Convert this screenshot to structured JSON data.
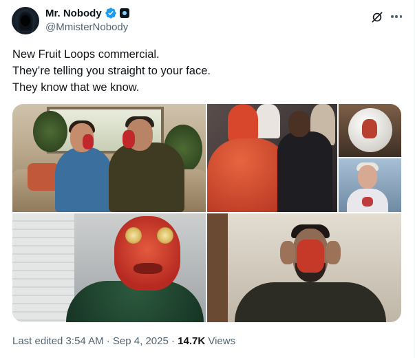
{
  "author": {
    "display_name": "Mr. Nobody",
    "handle": "@MmisterNobody",
    "verified_color": "#1d9bf0"
  },
  "header_icons": [
    "grok-icon",
    "more-icon"
  ],
  "tweet": {
    "lines": [
      "New Fruit Loops commercial.",
      "They’re telling you straight to your face.",
      "They know that we know."
    ]
  },
  "footer": {
    "edited": "Last edited 3:54 AM · Sep 4, 2025 · ",
    "views_count": "14.7K",
    "views_label": " Views"
  }
}
